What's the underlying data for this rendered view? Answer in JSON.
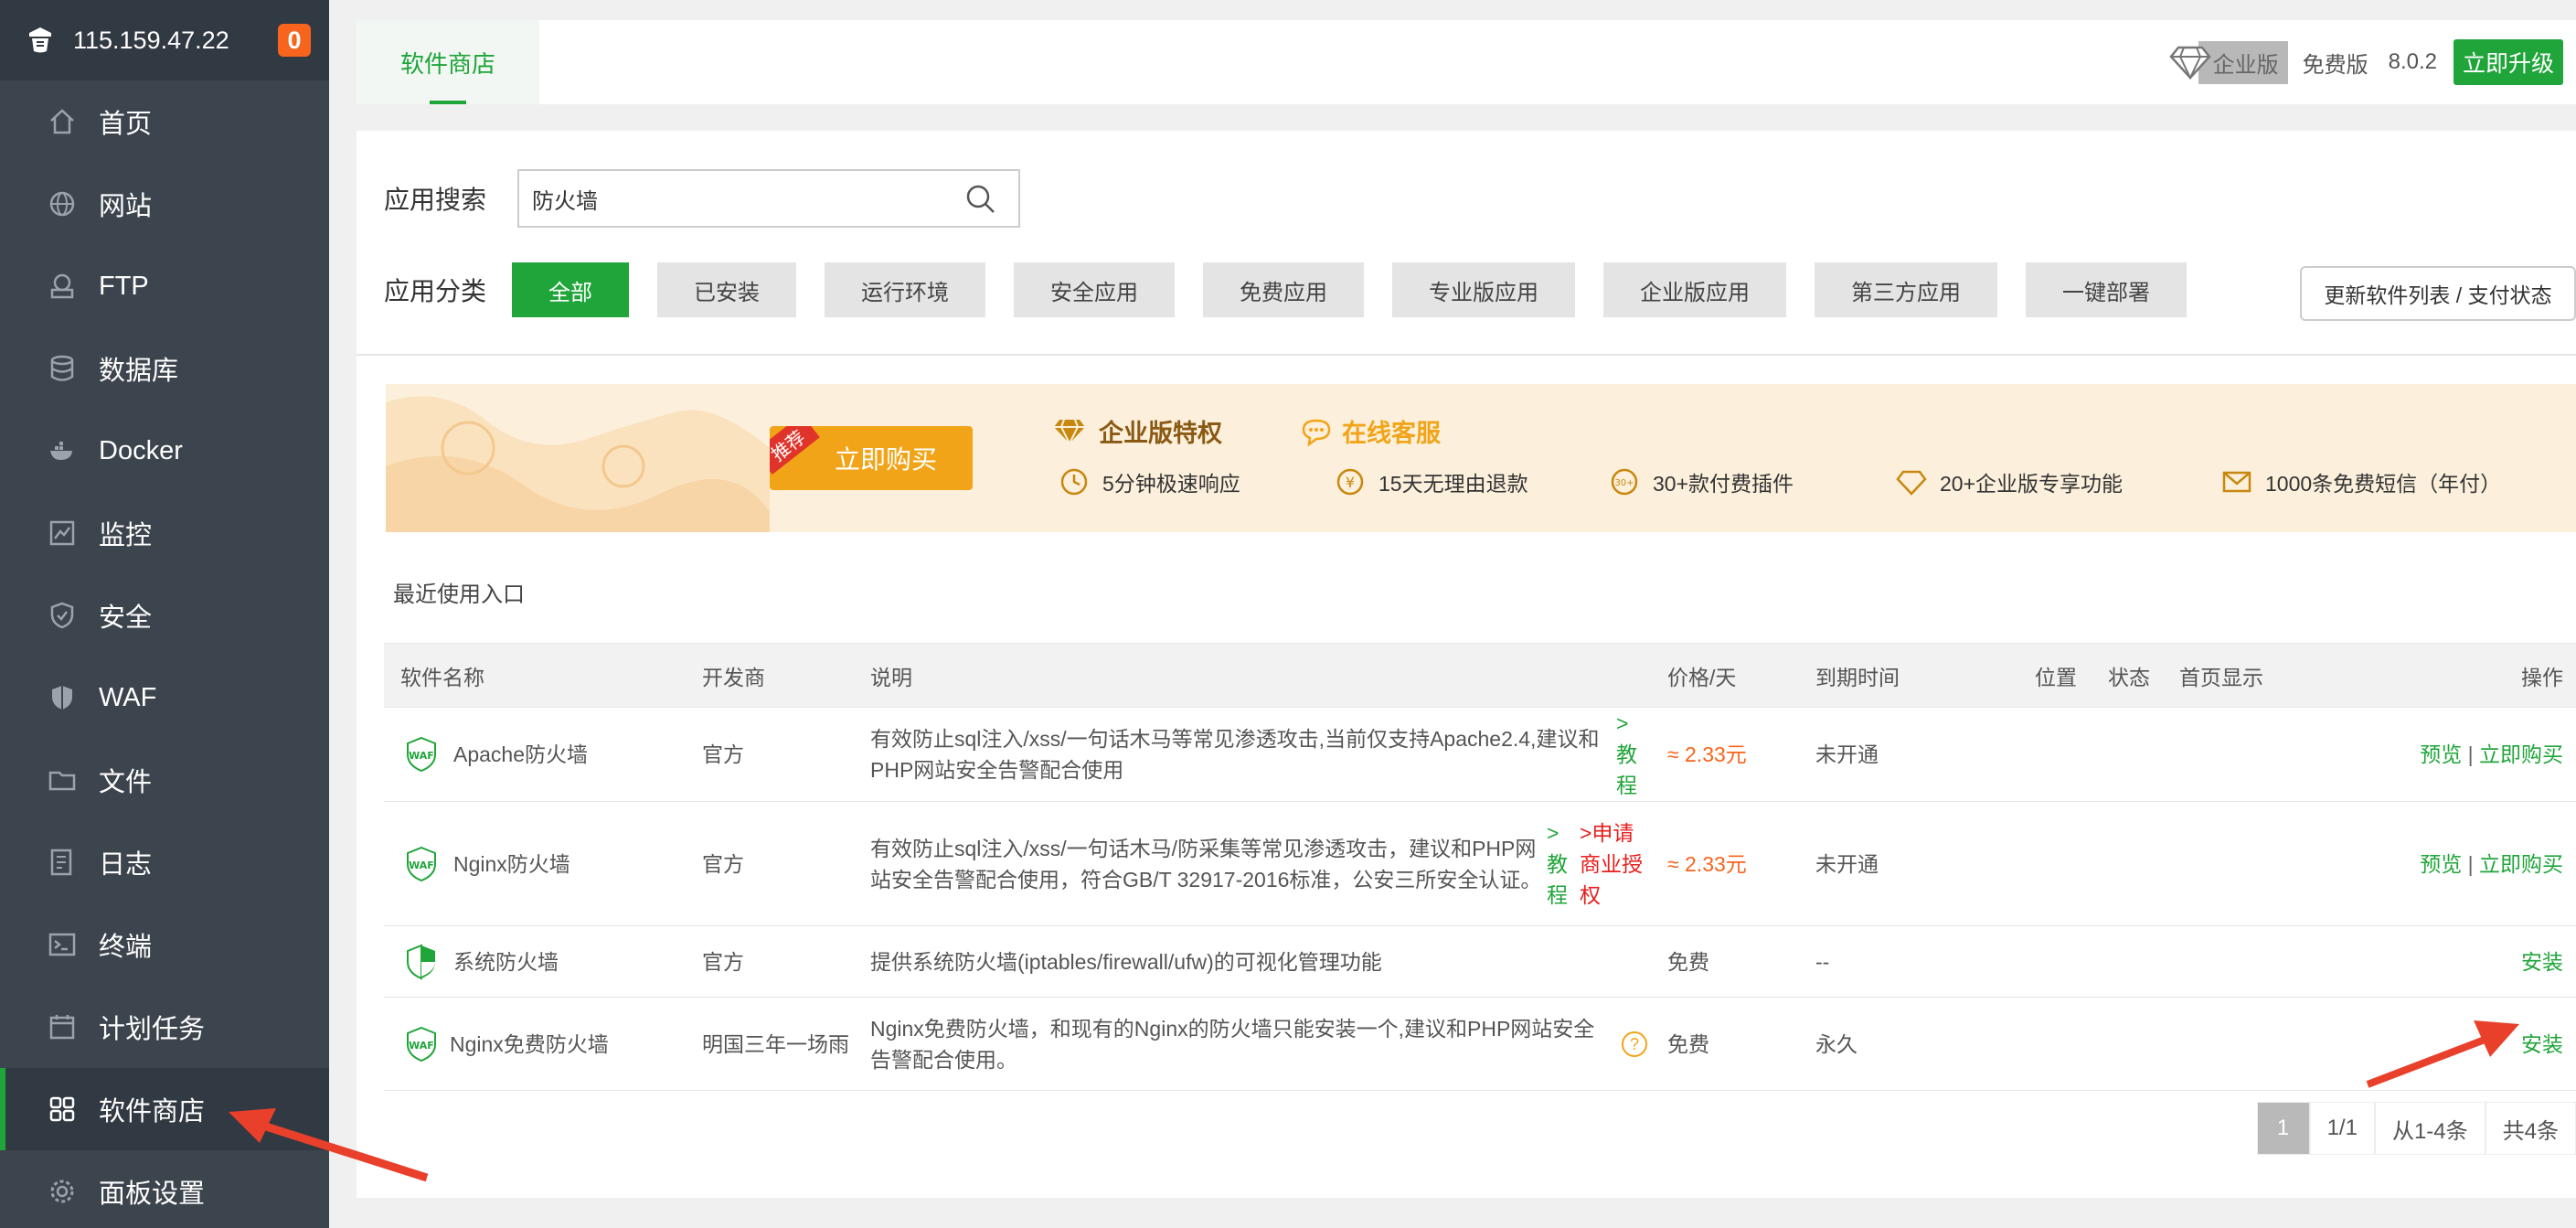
{
  "sidebar": {
    "ip": "115.159.47.22",
    "badge": "0",
    "items": [
      {
        "label": "首页",
        "icon": "home-icon"
      },
      {
        "label": "网站",
        "icon": "globe-icon"
      },
      {
        "label": "FTP",
        "icon": "ftp-icon"
      },
      {
        "label": "数据库",
        "icon": "database-icon"
      },
      {
        "label": "Docker",
        "icon": "docker-icon"
      },
      {
        "label": "监控",
        "icon": "monitor-icon"
      },
      {
        "label": "安全",
        "icon": "shield-icon"
      },
      {
        "label": "WAF",
        "icon": "waf-icon"
      },
      {
        "label": "文件",
        "icon": "folder-icon"
      },
      {
        "label": "日志",
        "icon": "log-icon"
      },
      {
        "label": "终端",
        "icon": "terminal-icon"
      },
      {
        "label": "计划任务",
        "icon": "calendar-icon"
      },
      {
        "label": "软件商店",
        "icon": "grid-icon",
        "active": true
      },
      {
        "label": "面板设置",
        "icon": "gear-icon"
      }
    ]
  },
  "topbar": {
    "tab": "软件商店",
    "enterprise": "企业版",
    "free": "免费版",
    "version": "8.0.2",
    "upgrade": "立即升级"
  },
  "search": {
    "label": "应用搜索",
    "value": "防火墙"
  },
  "categories": {
    "label": "应用分类",
    "items": [
      "全部",
      "已安装",
      "运行环境",
      "安全应用",
      "免费应用",
      "专业版应用",
      "企业版应用",
      "第三方应用",
      "一键部署"
    ],
    "active": "全部",
    "refresh": "更新软件列表 / 支付状态"
  },
  "banner": {
    "ribbon": "推荐",
    "buy": "立即购买",
    "title": "企业版特权",
    "service": "在线客服",
    "features": [
      "5分钟极速响应",
      "15天无理由退款",
      "30+款付费插件",
      "20+企业版专享功能",
      "1000条免费短信（年付）"
    ]
  },
  "recent": "最近使用入口",
  "table": {
    "headers": [
      "软件名称",
      "开发商",
      "说明",
      "价格/天",
      "到期时间",
      "位置",
      "状态",
      "首页显示",
      "操作"
    ],
    "rows": [
      {
        "name": "Apache防火墙",
        "dev": "官方",
        "desc": "有效防止sql注入/xss/一句话木马等常见渗透攻击,当前仅支持Apache2.4,建议和PHP网站安全告警配合使用",
        "link1": ">教程",
        "price": "≈ 2.33元",
        "expire": "未开通",
        "preview": "预览",
        "sep": "|",
        "action": "立即购买"
      },
      {
        "name": "Nginx防火墙",
        "dev": "官方",
        "desc": "有效防止sql注入/xss/一句话木马/防采集等常见渗透攻击，建议和PHP网站安全告警配合使用，符合GB/T 32917-2016标准，公安三所安全认证。",
        "link1": ">教程",
        "link2": ">申请商业授权",
        "price": "≈ 2.33元",
        "expire": "未开通",
        "preview": "预览",
        "sep": "|",
        "action": "立即购买"
      },
      {
        "name": "系统防火墙",
        "dev": "官方",
        "desc": "提供系统防火墙(iptables/firewall/ufw)的可视化管理功能",
        "price": "免费",
        "expire": "--",
        "action": "安装"
      },
      {
        "name": "Nginx免费防火墙",
        "dev": "明国三年一场雨",
        "desc": "Nginx免费防火墙，和现有的Nginx的防火墙只能安装一个,建议和PHP网站安全告警配合使用。",
        "help": "?",
        "price": "免费",
        "expire": "永久",
        "action": "安装"
      }
    ]
  },
  "pager": {
    "current": "1",
    "pages": "1/1",
    "range": "从1-4条",
    "total": "共4条"
  },
  "colors": {
    "accent": "#20a53a",
    "price": "#f7641d",
    "sidebar": "#3c444d",
    "arrow": "#e8402a"
  }
}
